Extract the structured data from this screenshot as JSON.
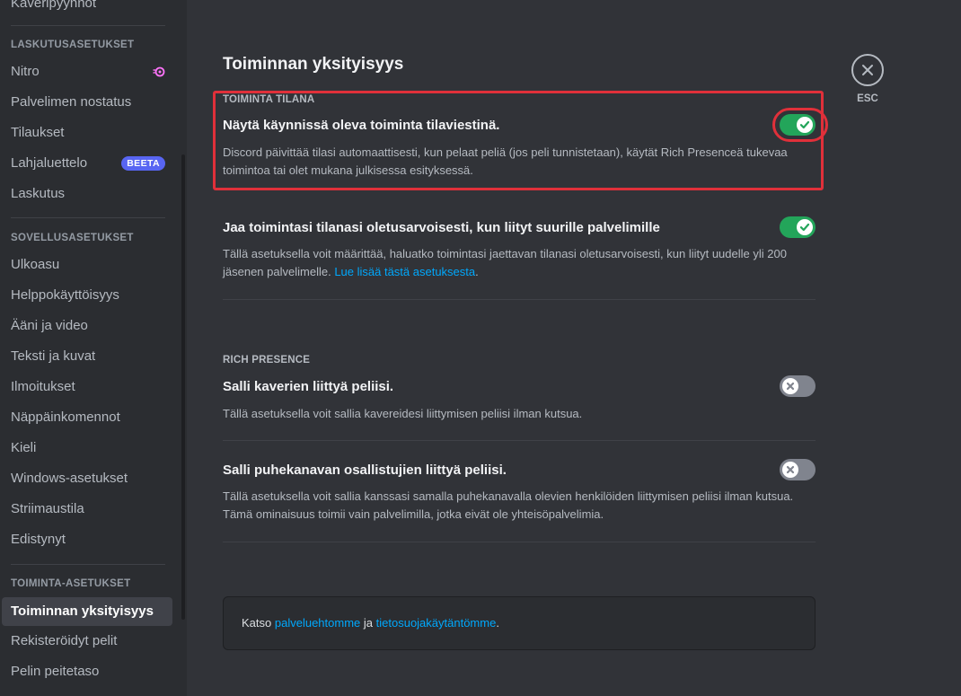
{
  "sidebar": {
    "top_item": "Kaveripyynnöt",
    "billing_header": "LASKUTUSASETUKSET",
    "billing_items": [
      {
        "label": "Nitro"
      },
      {
        "label": "Palvelimen nostatus"
      },
      {
        "label": "Tilaukset"
      },
      {
        "label": "Lahjaluettelo",
        "badge": "BEETA"
      },
      {
        "label": "Laskutus"
      }
    ],
    "app_header": "SOVELLUSASETUKSET",
    "app_items": [
      {
        "label": "Ulkoasu"
      },
      {
        "label": "Helppokäyttöisyys"
      },
      {
        "label": "Ääni ja video"
      },
      {
        "label": "Teksti ja kuvat"
      },
      {
        "label": "Ilmoitukset"
      },
      {
        "label": "Näppäinkomennot"
      },
      {
        "label": "Kieli"
      },
      {
        "label": "Windows-asetukset"
      },
      {
        "label": "Striimaustila"
      },
      {
        "label": "Edistynyt"
      }
    ],
    "activity_header": "TOIMINTA-ASETUKSET",
    "activity_items": [
      {
        "label": "Toiminnan yksityisyys",
        "active": true
      },
      {
        "label": "Rekisteröidyt pelit"
      },
      {
        "label": "Pelin peitetaso"
      }
    ]
  },
  "main": {
    "title": "Toiminnan yksityisyys",
    "status_section": {
      "header": "TOIMINTA TILANA",
      "settings": [
        {
          "title": "Näytä käynnissä oleva toiminta tilaviestinä.",
          "description": "Discord päivittää tilasi automaattisesti, kun pelaat peliä (jos peli tunnistetaan), käytät Rich Presenceä tukevaa toimintoa tai olet mukana julkisessa esityksessä.",
          "enabled": true
        },
        {
          "title": "Jaa toimintasi tilanasi oletusarvoisesti, kun liityt suurille palvelimille",
          "description": "Tällä asetuksella voit määrittää, haluatko toimintasi jaettavan tilanasi oletusarvoisesti, kun liityt uudelle yli 200 jäsenen palvelimelle.",
          "link": "Lue lisää tästä asetuksesta",
          "link_suffix": ".",
          "enabled": true
        }
      ]
    },
    "rich_presence_section": {
      "header": "RICH PRESENCE",
      "settings": [
        {
          "title": "Salli kaverien liittyä peliisi.",
          "description": "Tällä asetuksella voit sallia kavereidesi liittymisen peliisi ilman kutsua.",
          "enabled": false
        },
        {
          "title": "Salli puhekanavan osallistujien liittyä peliisi.",
          "description": "Tällä asetuksella voit sallia kanssasi samalla puhekanavalla olevien henkilöiden liittymisen peliisi ilman kutsua. Tämä ominaisuus toimii vain palvelimilla, jotka eivät ole yhteisöpalvelimia.",
          "enabled": false
        }
      ]
    },
    "footer": {
      "prefix": "Katso",
      "terms_link": "palveluehtomme",
      "conjunction": "ja",
      "privacy_link": "tietosuojakäytäntömme",
      "suffix": "."
    }
  },
  "close": {
    "label": "ESC",
    "icon": "close-icon"
  },
  "colors": {
    "toggle_on": "#23a55a",
    "toggle_off": "#80848e",
    "highlight": "#e0303a",
    "link": "#00a8fc",
    "beta_badge": "#5865f2"
  }
}
